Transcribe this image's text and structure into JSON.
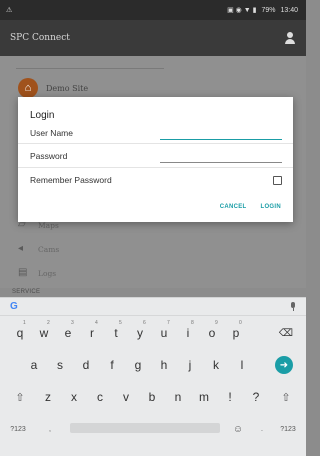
{
  "status_bar": {
    "left_icon": "notification-icon",
    "battery": "79%",
    "time": "13:40"
  },
  "app_bar": {
    "title": "SPC Connect",
    "right_icon": "person-icon"
  },
  "background": {
    "site_name": "Demo Site",
    "menu": [
      {
        "icon": "map-icon",
        "label": "Maps"
      },
      {
        "icon": "camera-icon",
        "label": "Cams"
      },
      {
        "icon": "log-icon",
        "label": "Logs"
      }
    ],
    "section_label": "SERVICE"
  },
  "dialog": {
    "title": "Login",
    "username_label": "User Name",
    "username_value": "",
    "password_label": "Password",
    "password_value": "",
    "remember_label": "Remember Password",
    "remember_checked": false,
    "cancel_label": "CANCEL",
    "login_label": "LOGIN"
  },
  "keyboard": {
    "brand_icon": "google-g-icon",
    "row1": [
      {
        "key": "q",
        "hint": "1"
      },
      {
        "key": "w",
        "hint": "2"
      },
      {
        "key": "e",
        "hint": "3"
      },
      {
        "key": "r",
        "hint": "4"
      },
      {
        "key": "t",
        "hint": "5"
      },
      {
        "key": "y",
        "hint": "6"
      },
      {
        "key": "u",
        "hint": "7"
      },
      {
        "key": "i",
        "hint": "8"
      },
      {
        "key": "o",
        "hint": "9"
      },
      {
        "key": "p",
        "hint": "0"
      }
    ],
    "row2": [
      "a",
      "s",
      "d",
      "f",
      "g",
      "h",
      "j",
      "k",
      "l"
    ],
    "row3": [
      "z",
      "x",
      "c",
      "v",
      "b",
      "n",
      "m",
      "!",
      "?"
    ],
    "row4_left": "?123",
    "row4_comma": ",",
    "row4_period": ".",
    "row4_right": "?123",
    "emoji": "☺",
    "accent": "#1a9da6"
  }
}
